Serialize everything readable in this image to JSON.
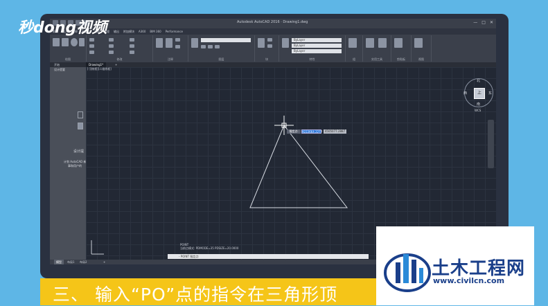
{
  "watermark": {
    "text": "秒dong视频"
  },
  "window": {
    "title": "Autodesk AutoCAD 2016 · Drawing1.dwg"
  },
  "menu": [
    "默认",
    "插入",
    "注释",
    "参数化",
    "视图",
    "管理",
    "输出",
    "附加模块",
    "A360",
    "BIM 360",
    "Performance"
  ],
  "ribbon": {
    "groups": [
      "绘图",
      "修改",
      "注释",
      "图层",
      "块",
      "特性",
      "组",
      "实用工具",
      "剪贴板",
      "视图"
    ],
    "layer_values": [
      "ByLayer",
      "ByLayer",
      "ByLayer"
    ]
  },
  "tabs": {
    "start": "开始",
    "drawing": "Drawing1*"
  },
  "left_panel": {
    "title": "设计提要",
    "heading": "设计提",
    "line1": "计划 AutoCAD 新",
    "line2": "事和用户的"
  },
  "viewport": {
    "label": "[-][俯视][二维线框]"
  },
  "compass": {
    "north": "北",
    "south": "南",
    "east": "东",
    "west": "西",
    "cube": "上",
    "wcs": "WCS"
  },
  "tooltip": {
    "label": "指定点:",
    "x_value": "9222664.2277",
    "y_value": "4505077.2887"
  },
  "command": {
    "history": [
      "POINT",
      "当前点模式:  PDMODE=35  PDSIZE=20.0000"
    ],
    "prompt": "- POINT 指定点:"
  },
  "layout_tabs": [
    "模型",
    "布局1",
    "布局2"
  ],
  "status": {
    "model_label": "模型"
  },
  "caption": {
    "text": "三、 输入“PO”点的指令在三角形顶"
  },
  "logo": {
    "name": "土木工程网",
    "url": "www.civilcn.com"
  }
}
